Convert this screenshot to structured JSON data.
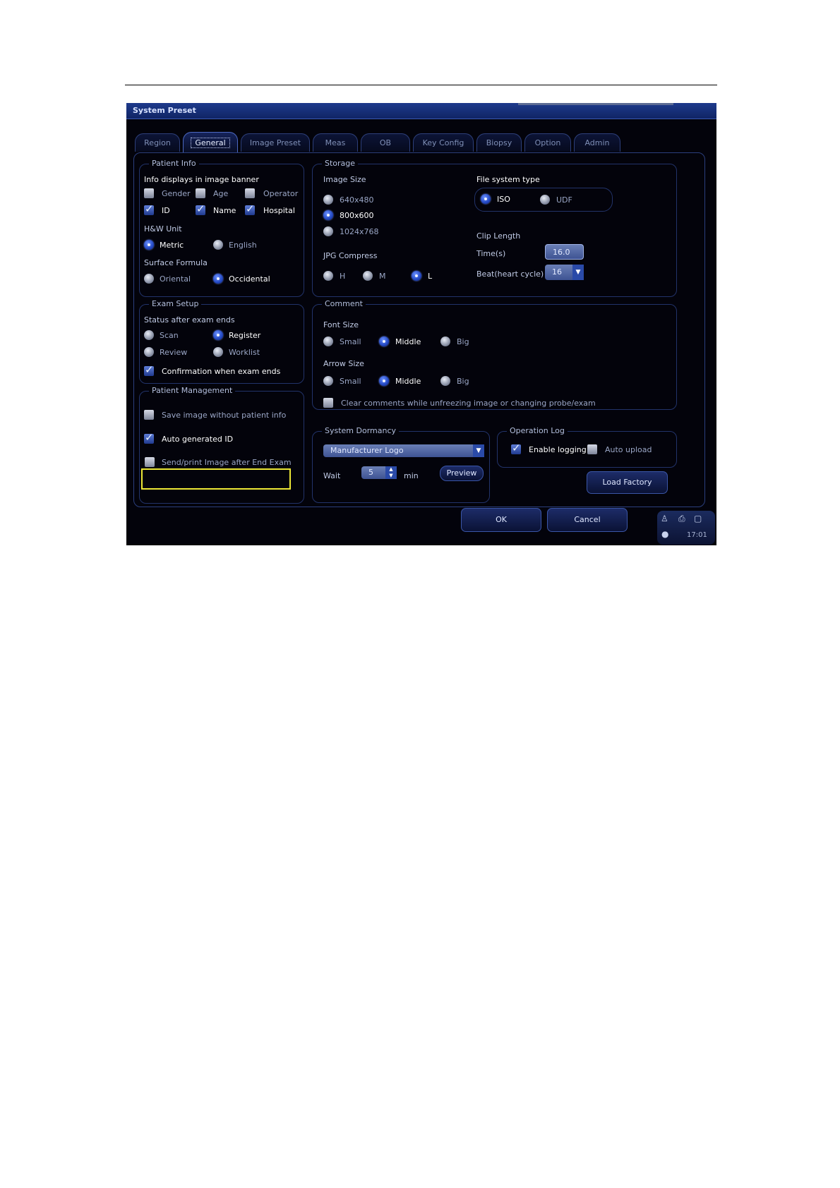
{
  "window": {
    "title": "System Preset"
  },
  "tabs": [
    "Region",
    "General",
    "Image Preset",
    "Meas",
    "OB",
    "Key Config",
    "Biopsy",
    "Option",
    "Admin"
  ],
  "active_tab": "General",
  "patient_info": {
    "legend": "Patient Info",
    "banner_label": "Info displays in image banner",
    "gender": {
      "label": "Gender",
      "checked": false
    },
    "age": {
      "label": "Age",
      "checked": false
    },
    "operator": {
      "label": "Operator",
      "checked": false
    },
    "id": {
      "label": "ID",
      "checked": true
    },
    "name": {
      "label": "Name",
      "checked": true
    },
    "hospital": {
      "label": "Hospital",
      "checked": true
    },
    "hw_unit_label": "H&W Unit",
    "metric": {
      "label": "Metric",
      "selected": true
    },
    "english": {
      "label": "English",
      "selected": false
    },
    "surface_formula_label": "Surface Formula",
    "oriental": {
      "label": "Oriental",
      "selected": false
    },
    "occidental": {
      "label": "Occidental",
      "selected": true
    }
  },
  "storage": {
    "legend": "Storage",
    "image_size_label": "Image Size",
    "size_640": {
      "label": "640x480",
      "selected": false
    },
    "size_800": {
      "label": "800x600",
      "selected": true
    },
    "size_1024": {
      "label": "1024x768",
      "selected": false
    },
    "jpg_compress_label": "JPG Compress",
    "h": {
      "label": "H",
      "selected": false
    },
    "m": {
      "label": "M",
      "selected": false
    },
    "l": {
      "label": "L",
      "selected": true
    },
    "fs_type_label": "File system type",
    "iso": {
      "label": "ISO",
      "selected": true
    },
    "udf": {
      "label": "UDF",
      "selected": false
    },
    "clip_length_label": "Clip Length",
    "time_label": "Time(s)",
    "time_value": "16.0",
    "beat_label": "Beat(heart cycle)",
    "beat_value": "16"
  },
  "exam_setup": {
    "legend": "Exam Setup",
    "status_label": "Status after exam ends",
    "scan": {
      "label": "Scan",
      "selected": false
    },
    "register": {
      "label": "Register",
      "selected": true
    },
    "review": {
      "label": "Review",
      "selected": false
    },
    "worklist": {
      "label": "Worklist",
      "selected": false
    },
    "confirmation": {
      "label": "Confirmation when exam ends",
      "checked": true
    }
  },
  "comment": {
    "legend": "Comment",
    "font_size_label": "Font Size",
    "font_small": {
      "label": "Small",
      "selected": false
    },
    "font_middle": {
      "label": "Middle",
      "selected": true
    },
    "font_big": {
      "label": "Big",
      "selected": false
    },
    "arrow_size_label": "Arrow Size",
    "arrow_small": {
      "label": "Small",
      "selected": false
    },
    "arrow_middle": {
      "label": "Middle",
      "selected": true
    },
    "arrow_big": {
      "label": "Big",
      "selected": false
    },
    "clear_comments": {
      "label": "Clear comments while unfreezing image or changing probe/exam",
      "checked": false
    }
  },
  "patient_management": {
    "legend": "Patient Management",
    "save_without_info": {
      "label": "Save image without patient info",
      "checked": false
    },
    "auto_id": {
      "label": "Auto generated ID",
      "checked": true
    },
    "send_print": {
      "label": "Send/print Image after End Exam",
      "checked": false
    }
  },
  "system_dormancy": {
    "legend": "System Dormancy",
    "selected": "Manufacturer Logo",
    "wait_label": "Wait",
    "wait_value": "5",
    "unit": "min",
    "preview_label": "Preview"
  },
  "operation_log": {
    "legend": "Operation Log",
    "enable_logging": {
      "label": "Enable logging",
      "checked": true
    },
    "auto_upload": {
      "label": "Auto upload",
      "checked": false
    }
  },
  "buttons": {
    "load_factory": "Load Factory",
    "ok": "OK",
    "cancel": "Cancel"
  },
  "tray": {
    "time": "17:01"
  },
  "colors": {
    "highlight": "#ece735",
    "background": "#03030b",
    "accent": "#2348c2"
  }
}
